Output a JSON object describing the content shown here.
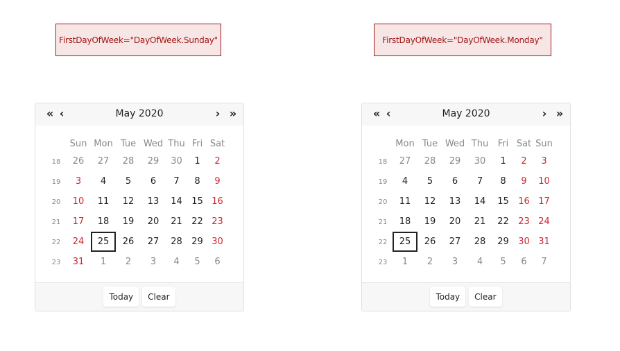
{
  "labels": {
    "left": "FirstDayOfWeek=\"DayOfWeek.Sunday\"",
    "right": "FirstDayOfWeek=\"DayOfWeek.Monday\""
  },
  "icons": {
    "prev_year": "«",
    "prev_month": "‹",
    "next_month": "›",
    "next_year": "»"
  },
  "calendars": [
    {
      "title": "May 2020",
      "weekdays": [
        "Sun",
        "Mon",
        "Tue",
        "Wed",
        "Thu",
        "Fri",
        "Sat"
      ],
      "weekend_columns": [
        0,
        6
      ],
      "weeks": [
        {
          "num": "18",
          "days": [
            {
              "d": "26",
              "o": true
            },
            {
              "d": "27",
              "o": true
            },
            {
              "d": "28",
              "o": true
            },
            {
              "d": "29",
              "o": true
            },
            {
              "d": "30",
              "o": true
            },
            {
              "d": "1"
            },
            {
              "d": "2"
            }
          ]
        },
        {
          "num": "19",
          "days": [
            {
              "d": "3"
            },
            {
              "d": "4"
            },
            {
              "d": "5"
            },
            {
              "d": "6"
            },
            {
              "d": "7"
            },
            {
              "d": "8"
            },
            {
              "d": "9"
            }
          ]
        },
        {
          "num": "20",
          "days": [
            {
              "d": "10"
            },
            {
              "d": "11"
            },
            {
              "d": "12"
            },
            {
              "d": "13"
            },
            {
              "d": "14"
            },
            {
              "d": "15"
            },
            {
              "d": "16"
            }
          ]
        },
        {
          "num": "21",
          "days": [
            {
              "d": "17"
            },
            {
              "d": "18"
            },
            {
              "d": "19"
            },
            {
              "d": "20"
            },
            {
              "d": "21"
            },
            {
              "d": "22"
            },
            {
              "d": "23"
            }
          ]
        },
        {
          "num": "22",
          "days": [
            {
              "d": "24"
            },
            {
              "d": "25",
              "s": true
            },
            {
              "d": "26"
            },
            {
              "d": "27"
            },
            {
              "d": "28"
            },
            {
              "d": "29"
            },
            {
              "d": "30"
            }
          ]
        },
        {
          "num": "23",
          "days": [
            {
              "d": "31"
            },
            {
              "d": "1",
              "o": true
            },
            {
              "d": "2",
              "o": true
            },
            {
              "d": "3",
              "o": true
            },
            {
              "d": "4",
              "o": true
            },
            {
              "d": "5",
              "o": true
            },
            {
              "d": "6",
              "o": true
            }
          ]
        }
      ],
      "today_label": "Today",
      "clear_label": "Clear"
    },
    {
      "title": "May 2020",
      "weekdays": [
        "Mon",
        "Tue",
        "Wed",
        "Thu",
        "Fri",
        "Sat",
        "Sun"
      ],
      "weekend_columns": [
        5,
        6
      ],
      "weeks": [
        {
          "num": "18",
          "days": [
            {
              "d": "27",
              "o": true
            },
            {
              "d": "28",
              "o": true
            },
            {
              "d": "29",
              "o": true
            },
            {
              "d": "30",
              "o": true
            },
            {
              "d": "1"
            },
            {
              "d": "2"
            },
            {
              "d": "3"
            }
          ]
        },
        {
          "num": "19",
          "days": [
            {
              "d": "4"
            },
            {
              "d": "5"
            },
            {
              "d": "6"
            },
            {
              "d": "7"
            },
            {
              "d": "8"
            },
            {
              "d": "9"
            },
            {
              "d": "10"
            }
          ]
        },
        {
          "num": "20",
          "days": [
            {
              "d": "11"
            },
            {
              "d": "12"
            },
            {
              "d": "13"
            },
            {
              "d": "14"
            },
            {
              "d": "15"
            },
            {
              "d": "16"
            },
            {
              "d": "17"
            }
          ]
        },
        {
          "num": "21",
          "days": [
            {
              "d": "18"
            },
            {
              "d": "19"
            },
            {
              "d": "20"
            },
            {
              "d": "21"
            },
            {
              "d": "22"
            },
            {
              "d": "23"
            },
            {
              "d": "24"
            }
          ]
        },
        {
          "num": "22",
          "days": [
            {
              "d": "25",
              "s": true
            },
            {
              "d": "26"
            },
            {
              "d": "27"
            },
            {
              "d": "28"
            },
            {
              "d": "29"
            },
            {
              "d": "30"
            },
            {
              "d": "31"
            }
          ]
        },
        {
          "num": "23",
          "days": [
            {
              "d": "1",
              "o": true
            },
            {
              "d": "2",
              "o": true
            },
            {
              "d": "3",
              "o": true
            },
            {
              "d": "4",
              "o": true
            },
            {
              "d": "5",
              "o": true
            },
            {
              "d": "6",
              "o": true
            },
            {
              "d": "7",
              "o": true
            }
          ]
        }
      ],
      "today_label": "Today",
      "clear_label": "Clear"
    }
  ]
}
